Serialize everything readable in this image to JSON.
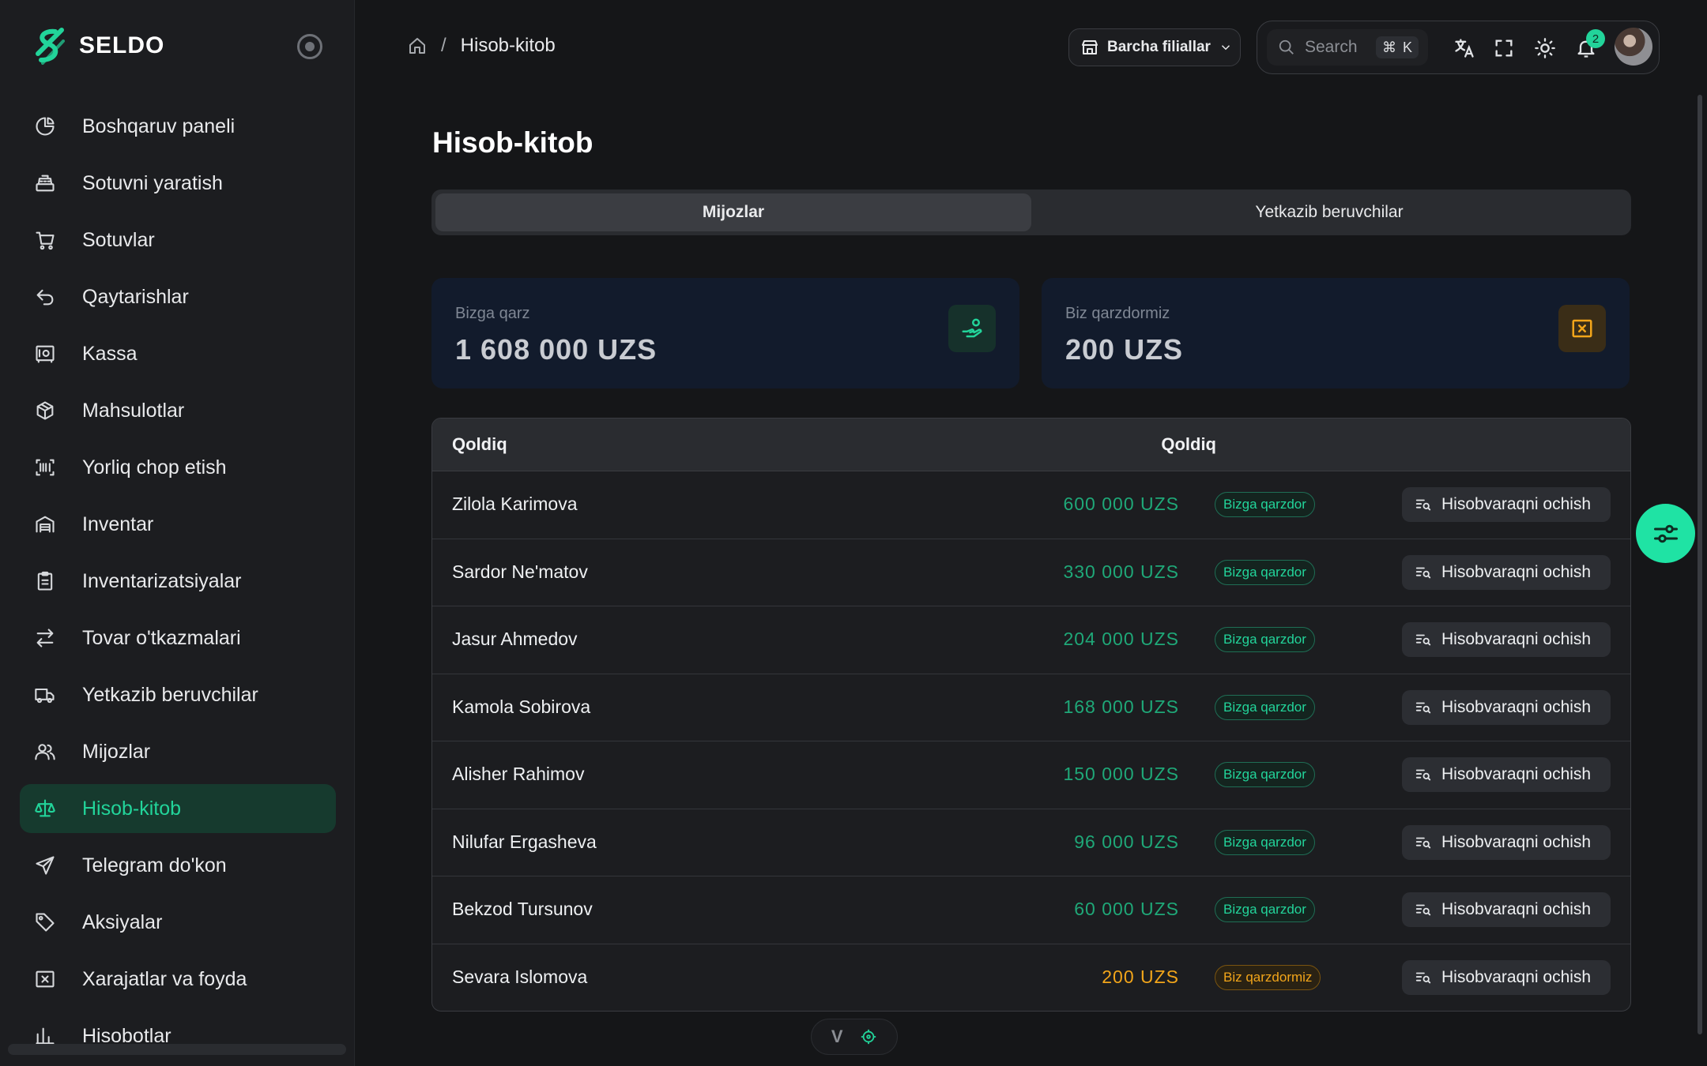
{
  "app": {
    "logo_text": "SELDO"
  },
  "sidebar": {
    "items": [
      {
        "label": "Boshqaruv paneli",
        "icon": "pie-chart-icon"
      },
      {
        "label": "Sotuvni yaratish",
        "icon": "cash-register-icon"
      },
      {
        "label": "Sotuvlar",
        "icon": "cart-icon"
      },
      {
        "label": "Qaytarishlar",
        "icon": "return-arrow-icon"
      },
      {
        "label": "Kassa",
        "icon": "safe-icon"
      },
      {
        "label": "Mahsulotlar",
        "icon": "box-icon"
      },
      {
        "label": "Yorliq chop etish",
        "icon": "barcode-icon"
      },
      {
        "label": "Inventar",
        "icon": "warehouse-icon"
      },
      {
        "label": "Inventarizatsiyalar",
        "icon": "clipboard-icon"
      },
      {
        "label": "Tovar o'tkazmalari",
        "icon": "transfer-arrows-icon"
      },
      {
        "label": "Yetkazib beruvchilar",
        "icon": "truck-icon"
      },
      {
        "label": "Mijozlar",
        "icon": "users-icon"
      },
      {
        "label": "Hisob-kitob",
        "icon": "scale-icon",
        "active": true
      },
      {
        "label": "Telegram do'kon",
        "icon": "send-icon"
      },
      {
        "label": "Aksiyalar",
        "icon": "tag-icon"
      },
      {
        "label": "Xarajatlar va foyda",
        "icon": "receipt-x-icon"
      },
      {
        "label": "Hisobotlar",
        "icon": "report-icon"
      }
    ]
  },
  "header": {
    "breadcrumb_current": "Hisob-kitob",
    "breadcrumb_sep": "/",
    "branch_label": "Barcha filiallar",
    "search_placeholder": "Search",
    "search_shortcut_mod": "⌘",
    "search_shortcut_key": "K",
    "notification_count": "2"
  },
  "page": {
    "title": "Hisob-kitob",
    "tabs": [
      "Mijozlar",
      "Yetkazib beruvchilar"
    ],
    "active_tab": 0
  },
  "cards": {
    "owed_to_us": {
      "label": "Bizga qarz",
      "value": "1 608 000 UZS"
    },
    "we_owe": {
      "label": "Biz qarzdormiz",
      "value": "200 UZS"
    }
  },
  "table": {
    "headers": [
      "Qoldiq",
      "Qoldiq"
    ],
    "action_label": "Hisobvaraqni ochish",
    "rows": [
      {
        "name": "Zilola Karimova",
        "amount": "600 000 UZS",
        "status": "Bizga qarzdor",
        "kind": "pos"
      },
      {
        "name": "Sardor Ne'matov",
        "amount": "330 000 UZS",
        "status": "Bizga qarzdor",
        "kind": "pos"
      },
      {
        "name": "Jasur Ahmedov",
        "amount": "204 000 UZS",
        "status": "Bizga qarzdor",
        "kind": "pos"
      },
      {
        "name": "Kamola Sobirova",
        "amount": "168 000 UZS",
        "status": "Bizga qarzdor",
        "kind": "pos"
      },
      {
        "name": "Alisher Rahimov",
        "amount": "150 000 UZS",
        "status": "Bizga qarzdor",
        "kind": "pos"
      },
      {
        "name": "Nilufar Ergasheva",
        "amount": "96 000 UZS",
        "status": "Bizga qarzdor",
        "kind": "pos"
      },
      {
        "name": "Bekzod Tursunov",
        "amount": "60 000 UZS",
        "status": "Bizga qarzdor",
        "kind": "pos"
      },
      {
        "name": "Sevara Islomova",
        "amount": "200 UZS",
        "status": "Biz qarzdormiz",
        "kind": "neg"
      }
    ]
  },
  "dev_toolbar": {
    "vue_label": "V"
  },
  "colors": {
    "accent": "#22d49a",
    "warning": "#f2a51a",
    "background": "#151618"
  }
}
